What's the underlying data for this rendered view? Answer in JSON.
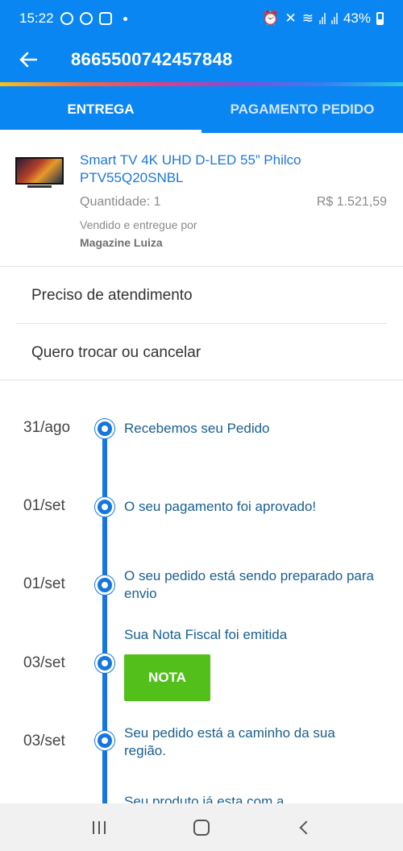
{
  "status_bar": {
    "time": "15:22",
    "battery": "43%"
  },
  "header": {
    "order_number": "8665500742457848",
    "back_icon": "arrow-left-icon"
  },
  "tabs": [
    {
      "label": "ENTREGA",
      "active": true
    },
    {
      "label": "PAGAMENTO PEDIDO",
      "active": false
    }
  ],
  "product": {
    "name": "Smart TV 4K UHD D-LED 55” Philco PTV55Q20SNBL",
    "quantity": "Quantidade: 1",
    "price": "R$ 1.521,59",
    "sold_by_label": "Vendido e entregue por",
    "seller": "Magazine Luiza"
  },
  "options": [
    {
      "label": "Preciso de atendimento"
    },
    {
      "label": "Quero trocar ou cancelar"
    }
  ],
  "timeline": [
    {
      "date": "31/ago",
      "text": "Recebemos seu Pedido"
    },
    {
      "date": "01/set",
      "text": "O seu pagamento foi aprovado!"
    },
    {
      "date": "01/set",
      "text": "O seu pedido está sendo preparado para envio"
    },
    {
      "date": "03/set",
      "text": "Sua Nota Fiscal foi emitida",
      "button": "NOTA"
    },
    {
      "date": "03/set",
      "text": "Seu pedido está a caminho da sua região."
    },
    {
      "date": "",
      "text": "Seu produto já esta com a"
    }
  ],
  "colors": {
    "primary": "#0a86f2",
    "timeline": "#1576e0",
    "link": "#1b78d8",
    "nota_button": "#52bf1a"
  }
}
